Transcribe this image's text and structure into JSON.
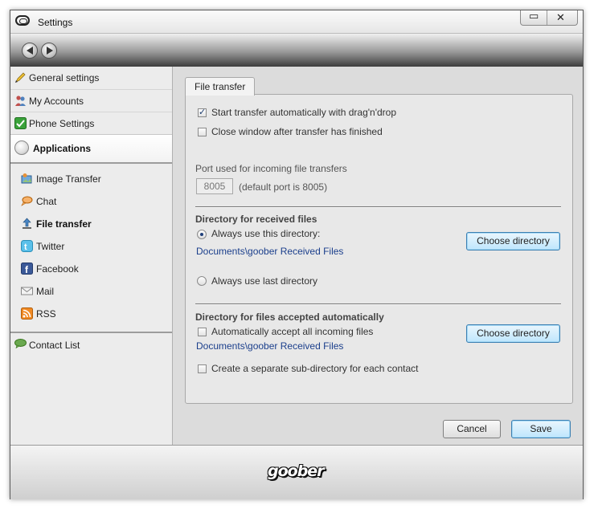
{
  "window": {
    "title": "Settings",
    "minimize_glyph": "▭",
    "close_glyph": "✕"
  },
  "sidebar": {
    "items": [
      {
        "label": "General settings",
        "icon": "pencil-icon"
      },
      {
        "label": "My Accounts",
        "icon": "people-icon"
      },
      {
        "label": "Phone Settings",
        "icon": "check-icon"
      }
    ],
    "applications": {
      "label": "Applications",
      "icon": "disc-icon"
    },
    "subitems": [
      {
        "label": "Image Transfer",
        "icon": "image-transfer-icon"
      },
      {
        "label": "Chat",
        "icon": "chat-bubble-icon"
      },
      {
        "label": "File transfer",
        "icon": "upload-arrow-icon",
        "active": true
      },
      {
        "label": "Twitter",
        "icon": "twitter-icon"
      },
      {
        "label": "Facebook",
        "icon": "facebook-icon"
      },
      {
        "label": "Mail",
        "icon": "mail-icon"
      },
      {
        "label": "RSS",
        "icon": "rss-icon"
      }
    ],
    "contact_list": {
      "label": "Contact List",
      "icon": "contact-bubble-icon"
    }
  },
  "tab": {
    "label": "File transfer"
  },
  "options": {
    "start_auto": {
      "label": "Start transfer automatically with drag'n'drop",
      "checked": true
    },
    "close_window": {
      "label": "Close window after transfer has finished",
      "checked": false
    }
  },
  "port": {
    "label": "Port used for incoming file transfers",
    "value": "8005",
    "hint": "(default port is 8005)"
  },
  "received": {
    "heading": "Directory for received files",
    "always_use": "Always use this directory:",
    "path": "Documents\\goober Received Files",
    "choose": "Choose directory",
    "last_dir": "Always use last directory"
  },
  "auto_accept": {
    "heading": "Directory for files accepted automatically",
    "accept_all": "Automatically accept all incoming files",
    "path": "Documents\\goober Received Files",
    "choose": "Choose directory",
    "subdir": "Create a separate sub-directory for each contact"
  },
  "buttons": {
    "cancel": "Cancel",
    "save": "Save"
  },
  "footer": {
    "logo": "goober"
  },
  "colors": {
    "link": "#1b3f8c",
    "focus_border": "#3c7fb1"
  }
}
